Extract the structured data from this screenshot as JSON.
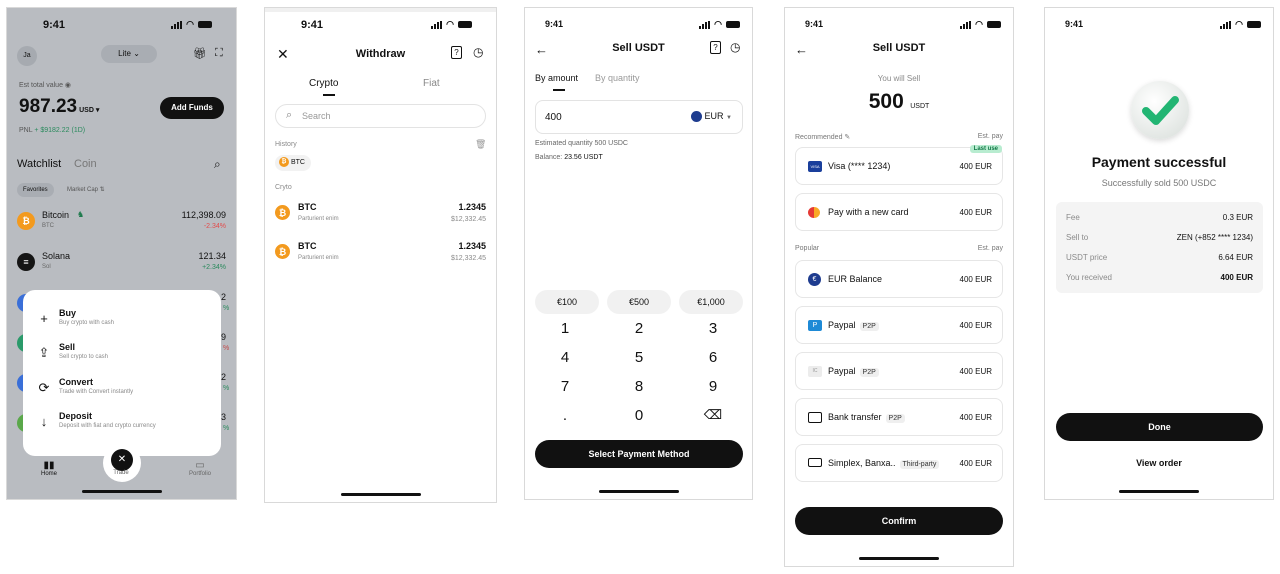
{
  "status_time": "9:41",
  "screen1": {
    "avatar": "Ja",
    "mode": "Lite",
    "est_label": "Est total value",
    "total": "987.23",
    "currency": "USD",
    "add_funds": "Add Funds",
    "pnl_label": "PNL",
    "pnl_value": "+ $9182.22 (1D)",
    "tabs": [
      "Watchlist",
      "Coin"
    ],
    "filters": [
      "Favorites",
      "Market Cap"
    ],
    "coins": [
      {
        "name": "Bitcoin",
        "symbol": "BTC",
        "price": "112,398.09",
        "change": "-2.34%"
      },
      {
        "name": "Solana",
        "symbol": "Sol",
        "price": "121.34",
        "change": "+2.34%"
      }
    ],
    "partial_prices": [
      "2",
      "9",
      "2",
      "3"
    ],
    "partial_changes": [
      "%",
      "%",
      "%",
      "%"
    ],
    "menu": [
      {
        "title": "Buy",
        "sub": "Buy crypto with cash",
        "icon": "+"
      },
      {
        "title": "Sell",
        "sub": "Sell crypto to cash",
        "icon": "⇪"
      },
      {
        "title": "Convert",
        "sub": "Trade with Convert instantly",
        "icon": "⟳"
      },
      {
        "title": "Deposit",
        "sub": "Deposit with fiat and crypto currency",
        "icon": "↓"
      }
    ],
    "nav": [
      "Home",
      "Trade",
      "Portfolio"
    ]
  },
  "screen2": {
    "title": "Withdraw",
    "tabs": [
      "Crypto",
      "Fiat"
    ],
    "search_placeholder": "Search",
    "history_label": "History",
    "history_chip": "BTC",
    "section": "Cryto",
    "items": [
      {
        "name": "BTC",
        "sub": "Parturient enim",
        "amount": "1.2345",
        "value": "$12,332.45"
      },
      {
        "name": "BTC",
        "sub": "Parturient enim",
        "amount": "1.2345",
        "value": "$12,332.45"
      }
    ]
  },
  "screen3": {
    "title": "Sell USDT",
    "tabs": [
      "By amount",
      "By quantity"
    ],
    "amount": "400",
    "currency": "EUR",
    "estimated": "Estimated quantity 500 USDC",
    "balance_label": "Balance:",
    "balance_value": "23.56 USDT",
    "quick": [
      "€100",
      "€500",
      "€1,000"
    ],
    "keys": [
      "1",
      "2",
      "3",
      "4",
      "5",
      "6",
      "7",
      "8",
      "9",
      ".",
      "0",
      "⌫"
    ],
    "cta": "Select Payment Method"
  },
  "screen4": {
    "title": "Sell USDT",
    "you_will_sell": "You will Sell",
    "amount": "500",
    "unit": "USDT",
    "recommended": "Recommended",
    "est_pay": "Est. pay",
    "last_use": "Last use",
    "popular": "Popular",
    "methods_rec": [
      {
        "label": "Visa (**** 1234)",
        "amount": "400 EUR",
        "icon": "VISA",
        "tag": ""
      },
      {
        "label": "Pay with a new card",
        "amount": "400 EUR",
        "icon": "card",
        "tag": ""
      }
    ],
    "methods_pop": [
      {
        "label": "EUR Balance",
        "amount": "400 EUR",
        "tag": ""
      },
      {
        "label": "Paypal",
        "amount": "400 EUR",
        "tag": "P2P"
      },
      {
        "label": "Paypal",
        "amount": "400 EUR",
        "tag": "P2P"
      },
      {
        "label": "Bank transfer",
        "amount": "400 EUR",
        "tag": "P2P"
      },
      {
        "label": "Simplex, Banxa..",
        "amount": "400 EUR",
        "tag": "Third-party"
      }
    ],
    "confirm": "Confirm"
  },
  "screen5": {
    "title": "Payment successful",
    "subtitle": "Successfully sold 500 USDC",
    "rows": [
      {
        "k": "Fee",
        "v": "0.3 EUR"
      },
      {
        "k": "Sell to",
        "v": "ZEN (+852 **** 1234)"
      },
      {
        "k": "USDT price",
        "v": "6.64 EUR"
      },
      {
        "k": "You received",
        "v": "400 EUR"
      }
    ],
    "done": "Done",
    "view_order": "View order"
  },
  "colors": {
    "primary": "#1a1a1a",
    "success": "#1fa36a",
    "danger": "#e24c4c",
    "overlay": "#b8bcc2"
  }
}
